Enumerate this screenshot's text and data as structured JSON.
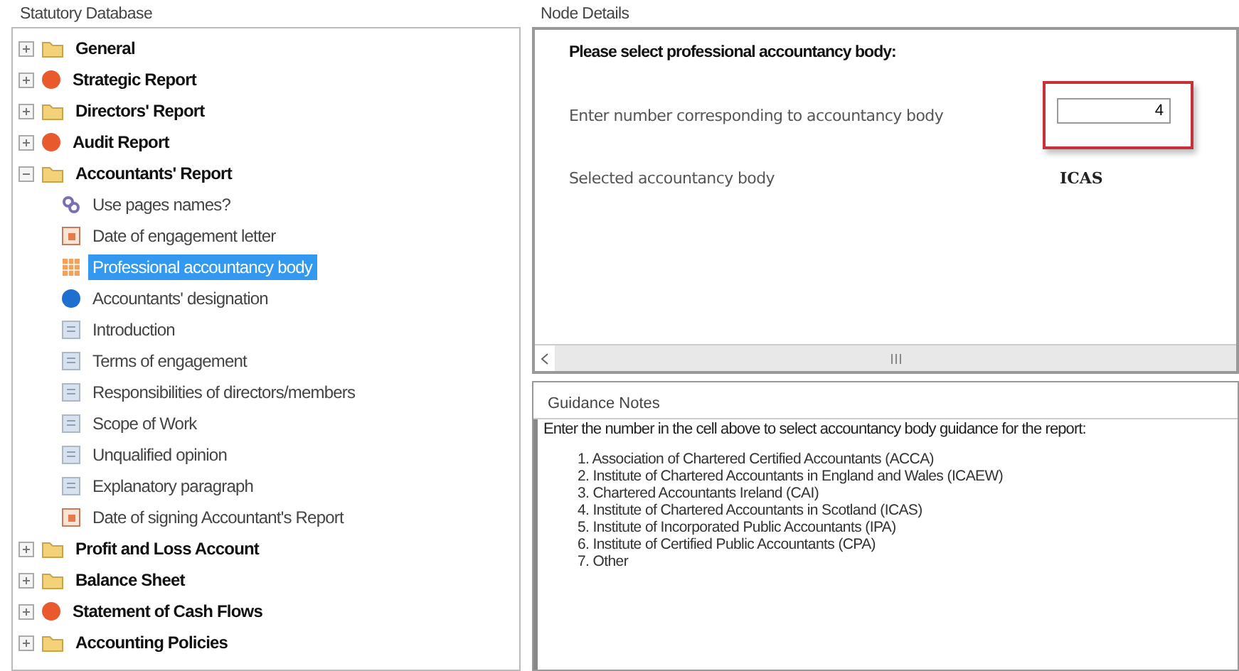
{
  "tree_panel": {
    "title": "Statutory Database",
    "items": [
      {
        "label": "General",
        "kind": "folder",
        "expanded": false,
        "selected": false
      },
      {
        "label": "Strategic Report",
        "kind": "dot",
        "color": "#e8592e",
        "expanded": false,
        "selected": false
      },
      {
        "label": "Directors' Report",
        "kind": "folder",
        "expanded": false,
        "selected": false
      },
      {
        "label": "Audit Report",
        "kind": "dot",
        "color": "#e8592e",
        "expanded": false,
        "selected": false
      },
      {
        "label": "Accountants' Report",
        "kind": "folder",
        "expanded": true,
        "selected": false,
        "children": [
          {
            "label": "Use pages names?",
            "kind": "link",
            "selected": false
          },
          {
            "label": "Date of engagement letter",
            "kind": "calendar",
            "selected": false
          },
          {
            "label": "Professional accountancy body",
            "kind": "grid",
            "selected": true
          },
          {
            "label": "Accountants' designation",
            "kind": "dot",
            "color": "#1e6fd0",
            "selected": false
          },
          {
            "label": "Introduction",
            "kind": "page",
            "selected": false
          },
          {
            "label": "Terms of engagement",
            "kind": "page",
            "selected": false
          },
          {
            "label": "Responsibilities of directors/members",
            "kind": "page",
            "selected": false
          },
          {
            "label": "Scope of Work",
            "kind": "page",
            "selected": false
          },
          {
            "label": "Unqualified opinion",
            "kind": "page",
            "selected": false
          },
          {
            "label": "Explanatory paragraph",
            "kind": "page",
            "selected": false
          },
          {
            "label": "Date of signing Accountant's Report",
            "kind": "calendar",
            "selected": false
          }
        ]
      },
      {
        "label": "Profit and Loss Account",
        "kind": "folder",
        "expanded": false,
        "selected": false
      },
      {
        "label": "Balance Sheet",
        "kind": "folder",
        "expanded": false,
        "selected": false
      },
      {
        "label": "Statement of Cash Flows",
        "kind": "dot",
        "color": "#e8592e",
        "expanded": false,
        "selected": false
      },
      {
        "label": "Accounting Policies",
        "kind": "folder",
        "expanded": false,
        "selected": false
      }
    ]
  },
  "node_details": {
    "title": "Node Details",
    "heading": "Please select professional accountancy body:",
    "fields": [
      {
        "kind": "input",
        "label": "Enter number corresponding to accountancy body",
        "value": "4",
        "highlighted": true
      },
      {
        "kind": "readout",
        "label": "Selected accountancy body",
        "value": "ICAS"
      }
    ]
  },
  "guidance_notes": {
    "title": "Guidance Notes",
    "intro": "Enter the number in the cell above to select accountancy body guidance for the report:",
    "options": [
      "1. Association of Chartered Certified Accountants (ACCA)",
      "2. Institute of Chartered Accountants in England and Wales (ICAEW)",
      "3. Chartered Accountants Ireland (CAI)",
      "4. Institute of Chartered Accountants in Scotland (ICAS)",
      "5. Institute of Incorporated Public Accountants (IPA)",
      "6. Institute of Certified Public Accountants (CPA)",
      "7. Other"
    ]
  }
}
